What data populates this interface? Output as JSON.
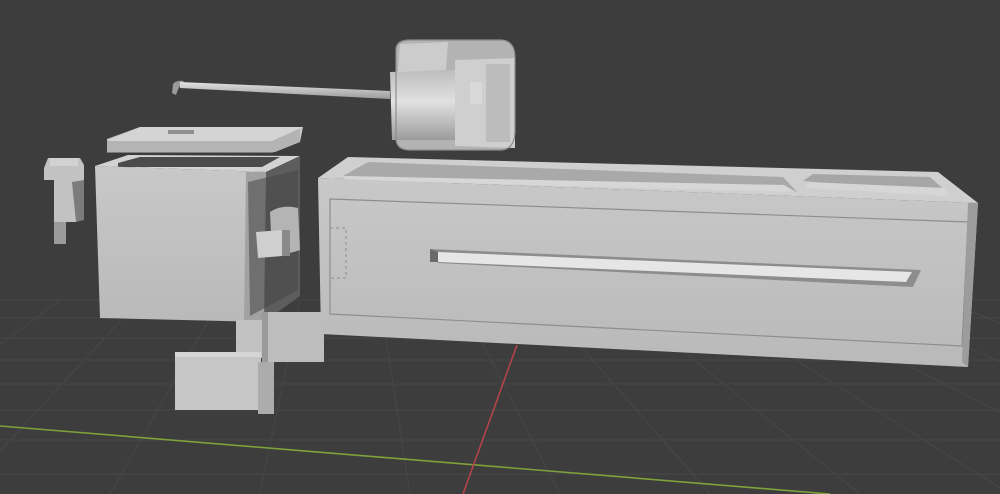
{
  "viewport": {
    "background": "#3d3d3d",
    "grid_color": "#4a4a4a",
    "x_axis_color": "#6e9a2e",
    "y_axis_color": "#b13a40",
    "mesh_light": "#c4c4c4",
    "mesh_mid": "#a9a9a9",
    "mesh_dark": "#7a7a7a",
    "mesh_shadow": "#4e4e4e"
  },
  "objects": [
    {
      "id": "tray-housing",
      "label_icon": "long-box-mesh"
    },
    {
      "id": "cubic-housing",
      "label_icon": "cube-mesh"
    },
    {
      "id": "lid-plate",
      "label_icon": "plate-mesh"
    },
    {
      "id": "knob-rod",
      "label_icon": "rod-with-knob-mesh"
    },
    {
      "id": "side-clip",
      "label_icon": "clip-mesh"
    },
    {
      "id": "base-block",
      "label_icon": "block-mesh"
    }
  ]
}
